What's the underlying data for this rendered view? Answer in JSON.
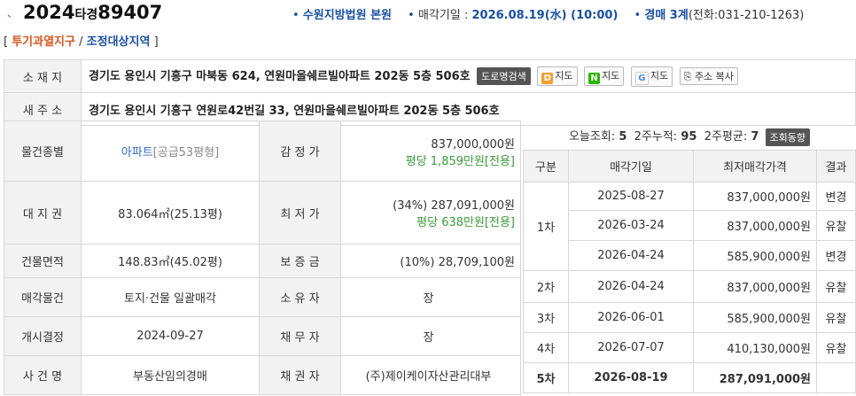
{
  "header": {
    "case_year": "2024",
    "case_type": "타경",
    "case_no": "89407",
    "court": "수원지방법원 본원",
    "sale_label": "매각기일 :",
    "sale_date": "2026.08.19(水) (10:00)",
    "dept": "경매 3계",
    "phone": "(전화:031-210-1263)"
  },
  "tags": {
    "open": "[",
    "t1": "투기과열지구",
    "slash": "/",
    "t2": "조정대상지역",
    "close": "]"
  },
  "address": {
    "label": "소 재 지",
    "value": "경기도 용인시 기흥구 마북동 624, 연원마을쉐르빌아파트 202동 5층 506호",
    "new_label": "새 주 소",
    "new_value": "경기도 용인시 기흥구 연원로42번길 33, 연원마을쉐르빌아파트 202동 5층 506호",
    "btn_road": "도로명검색",
    "btn_daum": "지도",
    "btn_naver": "지도",
    "btn_google": "지도",
    "btn_copy": "주소 복사",
    "icon_d": "D",
    "icon_n": "N",
    "icon_g": "G"
  },
  "info": {
    "type_label": "물건종별",
    "type_value": "아파트",
    "type_sub": "[공급53평형]",
    "appraisal_label": "감 정 가",
    "appraisal_value": "837,000,000원",
    "appraisal_sub": "평당 1,859만원[전용]",
    "land_label": "대 지 권",
    "land_value": "83.064㎡(25.13평)",
    "min_label": "최 저 가",
    "min_value": "(34%) 287,091,000원",
    "min_sub": "평당 638만원[전용]",
    "bldg_label": "건물면적",
    "bldg_value": "148.83㎡(45.02평)",
    "deposit_label": "보 증 금",
    "deposit_value": "(10%) 28,709,100원",
    "sale_type_label": "매각물건",
    "sale_type_value": "토지·건물 일괄매각",
    "owner_label": "소 유 자",
    "owner_value": "장",
    "start_label": "개시결정",
    "start_value": "2024-09-27",
    "debtor_label": "채 무 자",
    "debtor_value": "장",
    "case_name_label": "사 건 명",
    "case_name_value": "부동산임의경매",
    "creditor_label": "채 권 자",
    "creditor_value": "(주)제이케이자산관리대부"
  },
  "stats": {
    "today_label": "오늘조회:",
    "today": "5",
    "two_week_label": "2주누적:",
    "two_week": "95",
    "avg_label": "2주평균:",
    "avg": "7",
    "btn": "조회동향"
  },
  "history": {
    "headers": [
      "구분",
      "매각기일",
      "최저매각가격",
      "결과"
    ],
    "round1": "1차",
    "round2": "2차",
    "round3": "3차",
    "round4": "4차",
    "round5": "5차",
    "rows": [
      {
        "date": "2025-08-27",
        "price": "837,000,000원",
        "result": "변경"
      },
      {
        "date": "2026-03-24",
        "price": "837,000,000원",
        "result": "유찰"
      },
      {
        "date": "2026-04-24",
        "price": "585,900,000원",
        "result": "변경"
      },
      {
        "date": "2026-04-24",
        "price": "837,000,000원",
        "result": "유찰"
      },
      {
        "date": "2026-06-01",
        "price": "585,900,000원",
        "result": "유찰"
      },
      {
        "date": "2026-07-07",
        "price": "410,130,000원",
        "result": "유찰"
      },
      {
        "date": "2026-08-19",
        "price": "287,091,000원",
        "result": ""
      }
    ]
  }
}
